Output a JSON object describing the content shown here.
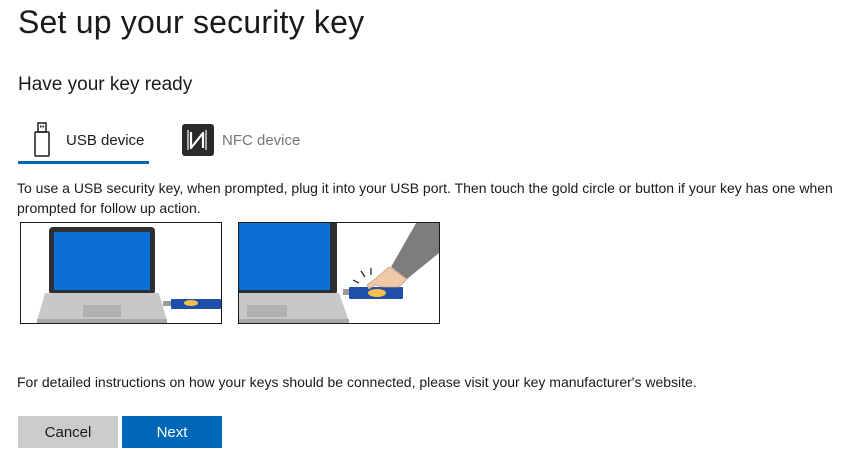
{
  "page": {
    "title": "Set up your security key",
    "subtitle": "Have your key ready"
  },
  "tabs": [
    {
      "label": "USB device",
      "icon": "usb-icon",
      "selected": true
    },
    {
      "label": "NFC device",
      "icon": "nfc-icon",
      "selected": false
    }
  ],
  "instruction": "To use a USB security key, when prompted, plug it into your USB port. Then touch the gold circle or button if your key has one when prompted for follow up action.",
  "footer_note": "For detailed instructions on how your keys should be connected, please visit your key manufacturer's website.",
  "buttons": {
    "cancel_label": "Cancel",
    "next_label": "Next"
  },
  "colors": {
    "accent": "#0067b8",
    "cancel_bg": "#cccccc",
    "screen_blue": "#0a6fd6",
    "key_gold": "#f2c14e"
  }
}
